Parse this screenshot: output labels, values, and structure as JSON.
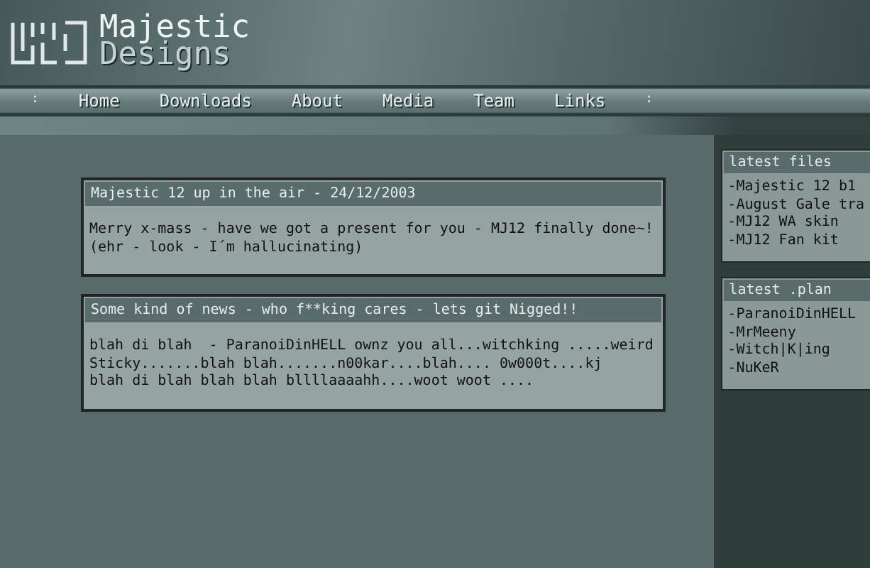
{
  "logo": {
    "line_1": "Majestic",
    "line_2": "Designs"
  },
  "nav": {
    "left_separator": ":",
    "items": [
      "Home",
      "Downloads",
      "About",
      "Media",
      "Team",
      "Links"
    ],
    "right_separator": ":"
  },
  "posts": [
    {
      "title": "Majestic 12 up in the air - 24/12/2003",
      "lines": [
        "Merry x-mass - have we got a present for you - MJ12 finally done~!",
        "(ehr - look - I´m hallucinating)"
      ]
    },
    {
      "title": "Some kind of news - who f**king cares - lets git Nigged!!",
      "lines": [
        "blah di blah  - ParanoiDinHELL ownz you all...witchking .....weird",
        "Sticky.......blah blah.......n00kar....blah.... 0w000t....kj",
        "blah di blah blah blah bllllaaaahh....woot woot ...."
      ]
    }
  ],
  "sidebar": [
    {
      "title": "latest files",
      "items": [
        "-Majestic 12 b1",
        "-August Gale tra",
        "-MJ12 WA skin",
        "-MJ12 Fan kit"
      ]
    },
    {
      "title": "latest .plan",
      "items": [
        "-ParanoiDinHELL",
        "-MrMeeny",
        "-Witch|K|ing",
        "-NuKeR"
      ]
    }
  ]
}
